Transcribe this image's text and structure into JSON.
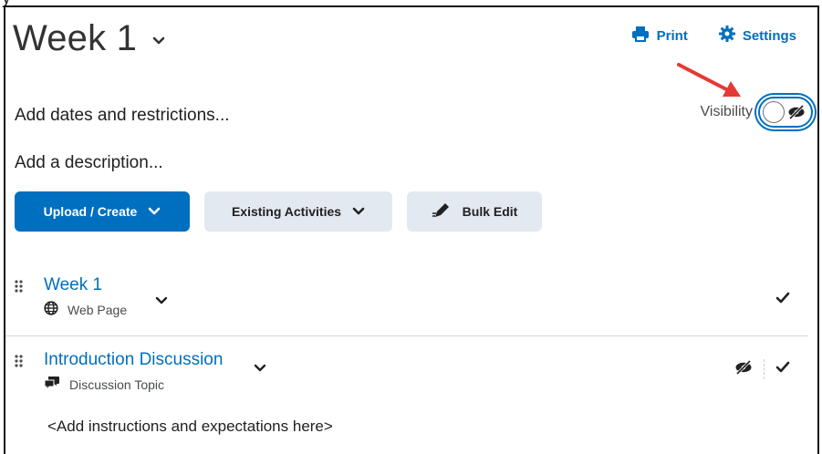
{
  "page": {
    "title": "Week 1",
    "top_strip_text": "y"
  },
  "header_actions": {
    "print_label": "Print",
    "settings_label": "Settings"
  },
  "module": {
    "restrictions_link": "Add dates and restrictions...",
    "description_link": "Add a description...",
    "visibility_label": "Visibility",
    "visibility_on": false
  },
  "buttons": {
    "upload_create": "Upload / Create",
    "existing_activities": "Existing Activities",
    "bulk_edit": "Bulk Edit"
  },
  "items": [
    {
      "title": "Week 1",
      "type": "Web Page",
      "icon": "globe-icon",
      "hidden": false,
      "completed": true
    },
    {
      "title": "Introduction Discussion",
      "type": "Discussion Topic",
      "icon": "discussion-icon",
      "hidden": true,
      "completed": true,
      "instructions": "<Add instructions and expectations here>"
    }
  ],
  "colors": {
    "accent": "#006fbf",
    "secondary_button": "#e3e9f1",
    "annotation_arrow": "#e53935"
  }
}
